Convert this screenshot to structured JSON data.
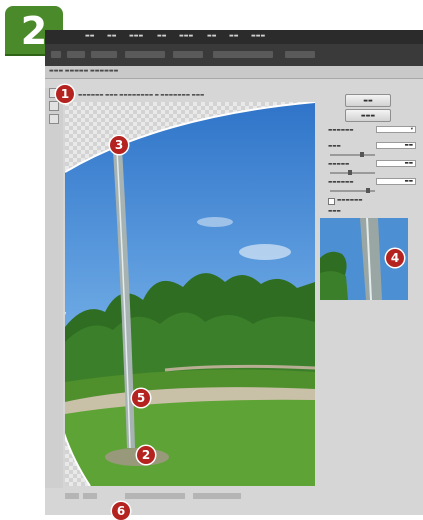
{
  "step_number": "2",
  "badges": [
    "1",
    "2",
    "3",
    "4",
    "5",
    "6"
  ],
  "colors": {
    "step_tab": "#4a8a2a",
    "badge": "#b4231f",
    "app_bar": "#2b2b2b",
    "dialog_bg": "#d6d6d6",
    "sky": "#4d8fd3",
    "grass": "#4f8f2c"
  },
  "icons": [
    "pole-straighten-tool",
    "hand-tool",
    "zoom-tool"
  ]
}
